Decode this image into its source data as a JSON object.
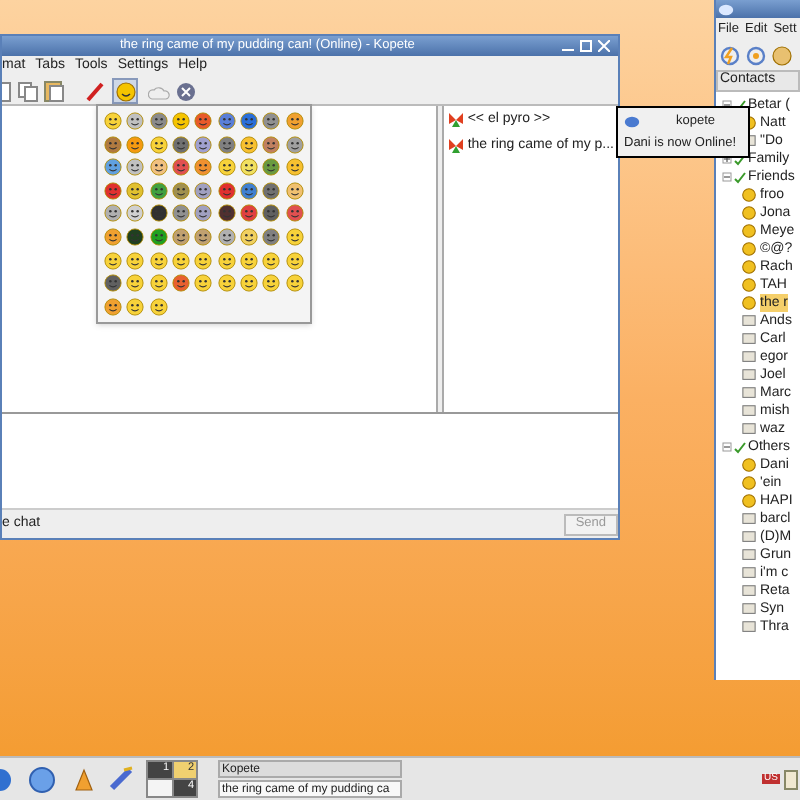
{
  "chat_window": {
    "title": "the ring came of my pudding can! (Online) - Kopete",
    "menu": [
      "mat",
      "Tabs",
      "Tools",
      "Settings",
      "Help"
    ],
    "members": [
      {
        "name": "<< el pyro >>"
      },
      {
        "name": "the ring came of my p..."
      }
    ],
    "status_text": "e chat",
    "send_button": {
      "label": "Send",
      "disabled": true
    }
  },
  "notification": {
    "title": "kopete",
    "message": "Dani is now Online!"
  },
  "contact_list": {
    "menu": [
      "File",
      "Edit",
      "Sett"
    ],
    "header": "Contacts",
    "groups": [
      {
        "name": "Betar (",
        "expanded": true,
        "children": [
          {
            "name": "Natt",
            "online": true,
            "selected": false
          },
          {
            "name": "\"Do",
            "online": false,
            "selected": false
          }
        ]
      },
      {
        "name": "Family",
        "expanded": false
      },
      {
        "name": "Friends",
        "expanded": true,
        "children": [
          {
            "name": "froo",
            "online": true,
            "selected": false
          },
          {
            "name": "Jona",
            "online": true,
            "selected": false
          },
          {
            "name": "Meye",
            "online": true,
            "selected": false
          },
          {
            "name": "©@?",
            "online": true,
            "selected": false
          },
          {
            "name": "Rach",
            "online": true,
            "selected": false
          },
          {
            "name": "TAH",
            "online": true,
            "selected": false
          },
          {
            "name": "the r",
            "online": true,
            "selected": true
          },
          {
            "name": "Ands",
            "online": false,
            "selected": false
          },
          {
            "name": "Carl",
            "online": false,
            "selected": false
          },
          {
            "name": "egor",
            "online": false,
            "selected": false
          },
          {
            "name": "Joel",
            "online": false,
            "selected": false
          },
          {
            "name": "Marc",
            "online": false,
            "selected": false
          },
          {
            "name": "mish",
            "online": false,
            "selected": false
          },
          {
            "name": "waz",
            "online": false,
            "selected": false
          }
        ]
      },
      {
        "name": "Others",
        "expanded": true,
        "children": [
          {
            "name": "Dani",
            "online": true,
            "selected": false
          },
          {
            "name": "'ein",
            "online": true,
            "selected": false
          },
          {
            "name": "HAPI",
            "online": true,
            "selected": false
          },
          {
            "name": "barcl",
            "online": false,
            "selected": false
          },
          {
            "name": "(D)M",
            "online": false,
            "selected": false
          },
          {
            "name": "Grun",
            "online": false,
            "selected": false
          },
          {
            "name": "i'm c",
            "online": false,
            "selected": false
          },
          {
            "name": "Reta",
            "online": false,
            "selected": false
          },
          {
            "name": "Syn",
            "online": false,
            "selected": false
          },
          {
            "name": "Thra",
            "online": false,
            "selected": false
          }
        ]
      }
    ]
  },
  "taskbar": {
    "pager": [
      {
        "label": "1",
        "selected": false
      },
      {
        "label": "2",
        "selected": true
      },
      {
        "selected": false
      },
      {
        "label": "4",
        "selected": false
      }
    ],
    "tasks": [
      {
        "label": "Kopete",
        "selected": false
      },
      {
        "label": "the ring came of my pudding ca",
        "selected": true
      }
    ],
    "tray_flag": "US"
  }
}
